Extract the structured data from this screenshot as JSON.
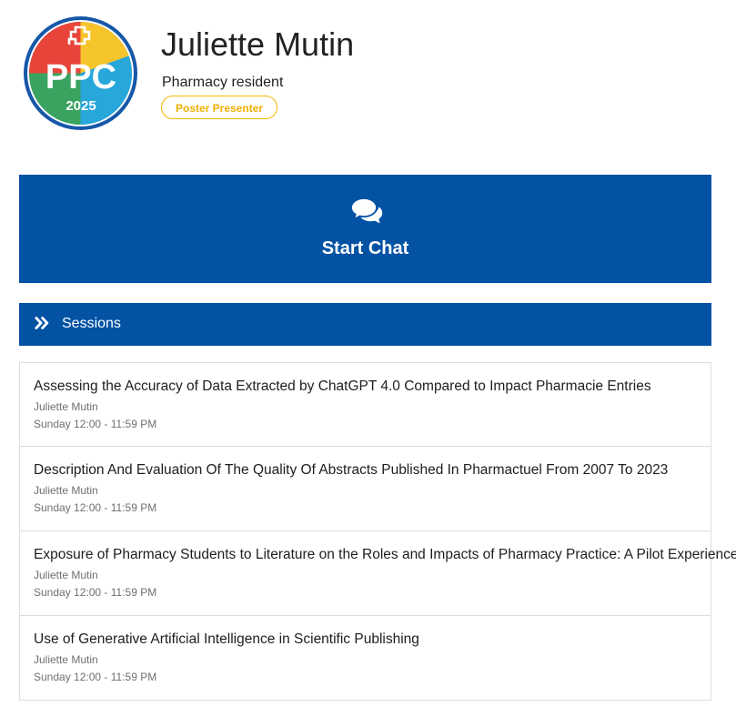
{
  "profile": {
    "name": "Juliette Mutin",
    "role": "Pharmacy resident",
    "badge": "Poster Presenter",
    "logo": {
      "text": "PPC",
      "year": "2025",
      "colors": {
        "ring": "#1657a8",
        "red": "#e8443a",
        "yellow": "#f6c52c",
        "green": "#3aa35f",
        "blue": "#27a7da"
      }
    }
  },
  "chat": {
    "label": "Start Chat",
    "icon": "comments-icon"
  },
  "sessions": {
    "header": "Sessions",
    "icon": "double-chevron-right-icon",
    "items": [
      {
        "title": "Assessing the Accuracy of Data Extracted by ChatGPT 4.0 Compared to Impact Pharmacie Entries",
        "speaker": "Juliette Mutin",
        "time": "Sunday 12:00 - 11:59 PM"
      },
      {
        "title": "Description And Evaluation Of The Quality Of Abstracts Published In Pharmactuel From 2007 To 2023",
        "speaker": "Juliette Mutin",
        "time": "Sunday 12:00 - 11:59 PM"
      },
      {
        "title": "Exposure of Pharmacy Students to Literature on the Roles and Impacts of Pharmacy Practice: A Pilot Experience",
        "speaker": "Juliette Mutin",
        "time": "Sunday 12:00 - 11:59 PM"
      },
      {
        "title": "Use of Generative Artificial Intelligence in Scientific Publishing",
        "speaker": "Juliette Mutin",
        "time": "Sunday 12:00 - 11:59 PM"
      }
    ]
  },
  "theme": {
    "primary": "#0352a4",
    "badge": "#f5b800",
    "border": "#dedede"
  }
}
